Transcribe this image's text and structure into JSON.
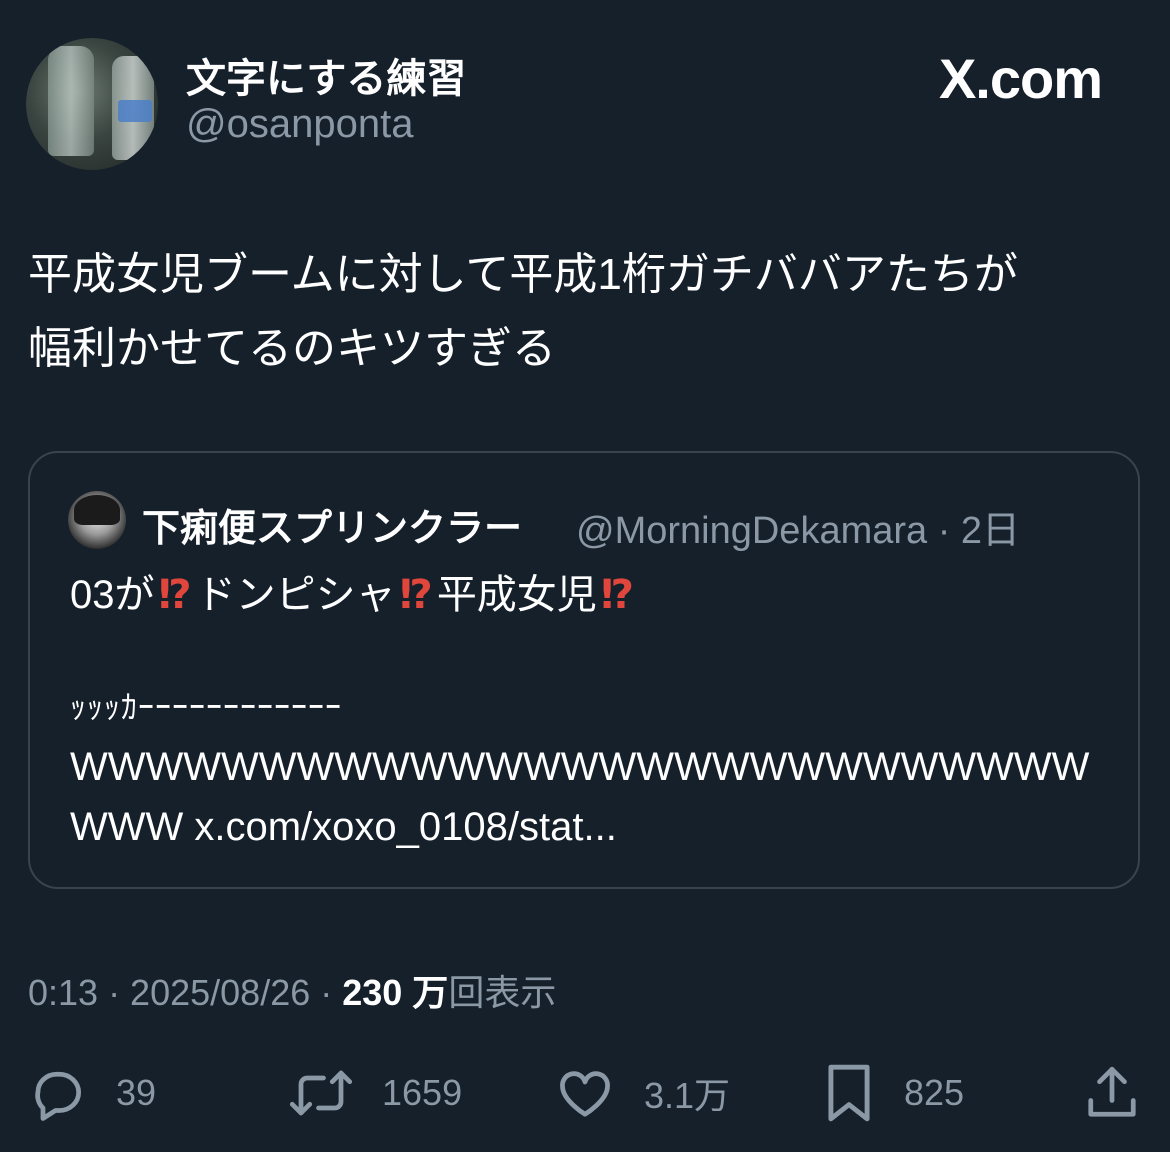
{
  "header": {
    "display_name": "文字にする練習",
    "handle": "@osanponta",
    "brand": "X.com"
  },
  "tweet": {
    "lines": [
      "平成女児ブームに対して平成1桁ガチババアたちが",
      "幅利かせてるのキツすぎる"
    ]
  },
  "quote": {
    "display_name": "下痢便スプリンクラー",
    "handle_time": "@MorningDekamara · 2日",
    "line1_parts": [
      "03が",
      "⁉",
      "ドンピシャ",
      "⁉",
      "平成女児",
      "⁉"
    ],
    "line2": "ｯｯｯｶｰｰｰｰｰｰｰｰｰｰｰｰ",
    "line3": "WWWWWWWWWWWWWWWWWWWWWWWWWWW",
    "line4": "WWW x.com/xoxo_0108/stat..."
  },
  "meta": {
    "time_date": "0:13 · 2025/08/26 · ",
    "views_count": "230 万",
    "views_label": "回表示"
  },
  "actions": {
    "replies": "39",
    "retweets": "1659",
    "likes": "3.1万",
    "bookmarks": "825"
  },
  "colors": {
    "background": "#15202b",
    "text": "#ffffff",
    "secondary": "#8b98a5",
    "border": "#38444d",
    "emoji_red": "#e0463c"
  },
  "icons": [
    "reply-icon",
    "retweet-icon",
    "like-icon",
    "bookmark-icon",
    "share-icon"
  ]
}
